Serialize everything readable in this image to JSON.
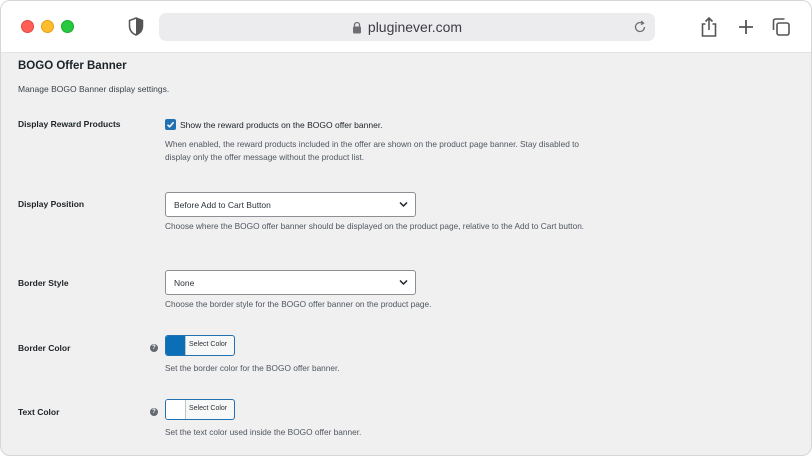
{
  "browser": {
    "url": "pluginever.com"
  },
  "page": {
    "title": "BOGO Offer Banner",
    "description": "Manage BOGO Banner display settings."
  },
  "settings": {
    "display_reward": {
      "label": "Display Reward Products",
      "checkbox_label": "Show the reward products on the BOGO offer banner.",
      "checked": true,
      "description": "When enabled, the reward products included in the offer are shown on the product page banner. Stay disabled to display only the offer message without the product list."
    },
    "display_position": {
      "label": "Display Position",
      "value": "Before Add to Cart Button",
      "description": "Choose where the BOGO offer banner should be displayed on the product page, relative to the Add to Cart button."
    },
    "border_style": {
      "label": "Border Style",
      "value": "None",
      "description": "Choose the border style for the BOGO offer banner on the product page."
    },
    "border_color": {
      "label": "Border Color",
      "button_label": "Select Color",
      "color": "#0a6fb7",
      "description": "Set the border color for the BOGO offer banner."
    },
    "text_color": {
      "label": "Text Color",
      "button_label": "Select Color",
      "color": "#ffffff",
      "description": "Set the text color used inside the BOGO offer banner."
    }
  },
  "icons": {
    "help": "question-circle-icon",
    "chevron": "chevron-down-icon",
    "check": "checkmark-icon"
  }
}
